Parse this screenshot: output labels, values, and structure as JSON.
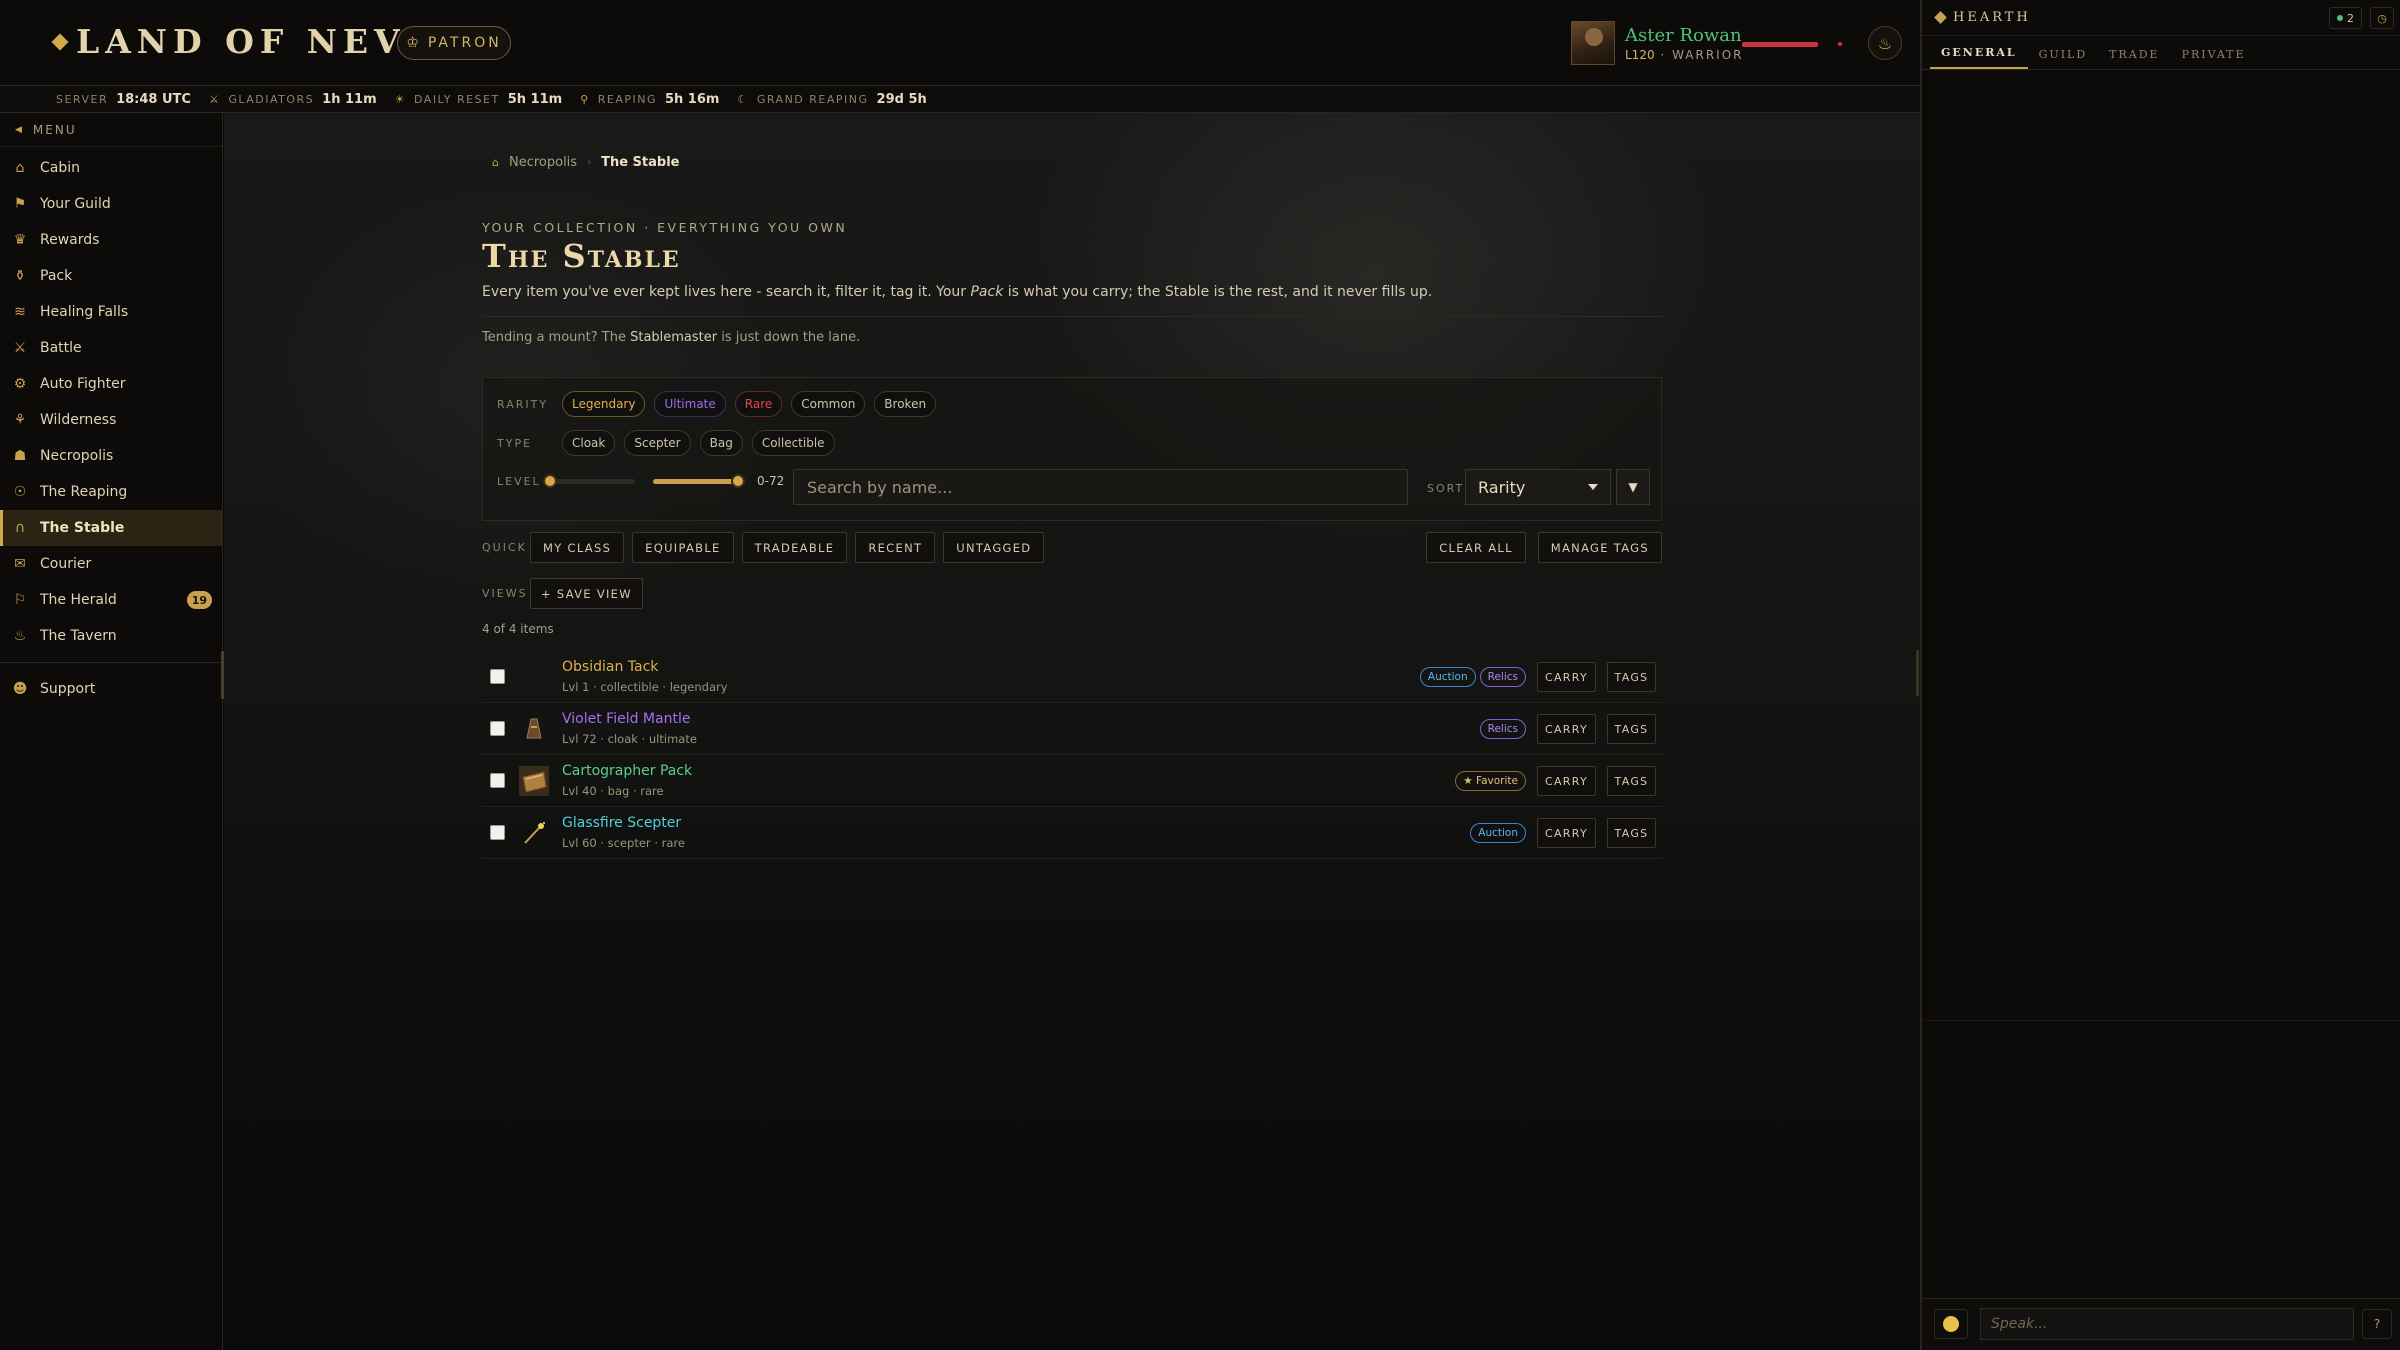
{
  "header": {
    "logo": "LAND OF NEVARD",
    "patron": "PATRON",
    "player": {
      "name": "Aster Rowan",
      "level": "L120",
      "class": "WARRIOR"
    }
  },
  "timers": [
    {
      "label": "SERVER",
      "value": "18:48 UTC",
      "icon": ""
    },
    {
      "label": "GLADIATORS",
      "value": "1h 11m",
      "icon": "⚔"
    },
    {
      "label": "DAILY RESET",
      "value": "5h 11m",
      "icon": "☀"
    },
    {
      "label": "REAPING",
      "value": "5h 16m",
      "icon": "⚲"
    },
    {
      "label": "GRAND REAPING",
      "value": "29d 5h",
      "icon": "☾"
    }
  ],
  "sidebar": {
    "menu_label": "MENU",
    "items": [
      {
        "label": "Cabin",
        "icon": "cabin-icon",
        "glyph": "⌂"
      },
      {
        "label": "Your Guild",
        "icon": "guild-icon",
        "glyph": "⚑"
      },
      {
        "label": "Rewards",
        "icon": "rewards-icon",
        "glyph": "♛"
      },
      {
        "label": "Pack",
        "icon": "pack-icon",
        "glyph": "⚱"
      },
      {
        "label": "Healing Falls",
        "icon": "healing-falls-icon",
        "glyph": "≋"
      },
      {
        "label": "Battle",
        "icon": "battle-icon",
        "glyph": "⚔"
      },
      {
        "label": "Auto Fighter",
        "icon": "auto-fighter-icon",
        "glyph": "⚙"
      },
      {
        "label": "Wilderness",
        "icon": "wilderness-icon",
        "glyph": "⚘"
      },
      {
        "label": "Necropolis",
        "icon": "necropolis-icon",
        "glyph": "☗"
      },
      {
        "label": "The Reaping",
        "icon": "reaping-icon",
        "glyph": "☉"
      },
      {
        "label": "The Stable",
        "icon": "horseshoe-icon",
        "glyph": "∩"
      },
      {
        "label": "Courier",
        "icon": "courier-icon",
        "glyph": "✉"
      },
      {
        "label": "The Herald",
        "icon": "herald-icon",
        "glyph": "⚐",
        "badge": "19"
      },
      {
        "label": "The Tavern",
        "icon": "tavern-icon",
        "glyph": "♨"
      }
    ],
    "support": {
      "label": "Support",
      "icon": "support-icon",
      "glyph": "☻"
    }
  },
  "breadcrumb": {
    "home": "Necropolis",
    "current": "The Stable"
  },
  "page": {
    "eyebrow": "YOUR COLLECTION · EVERYTHING YOU OWN",
    "title": "The Stable",
    "lede_a": "Every item you've ever kept lives here - search it, filter it, tag it. Your ",
    "lede_pack": "Pack",
    "lede_b": " is what you carry; the Stable is the rest, and it never fills up.",
    "tend_a": "Tending a mount? The ",
    "tend_link": "Stablemaster",
    "tend_b": " is just down the lane."
  },
  "filters": {
    "rarity_label": "RARITY",
    "rarity": [
      "Legendary",
      "Ultimate",
      "Rare",
      "Common",
      "Broken"
    ],
    "type_label": "TYPE",
    "types": [
      "Cloak",
      "Scepter",
      "Bag",
      "Collectible"
    ],
    "level_label": "LEVEL",
    "level_range": "0-72",
    "level_min": 0,
    "level_max": 72,
    "search_placeholder": "Search by name...",
    "sort_label": "SORT",
    "sort_value": "Rarity",
    "sort_dir_glyph": "▼"
  },
  "quick": {
    "label": "QUICK",
    "buttons": [
      "MY CLASS",
      "EQUIPABLE",
      "TRADEABLE",
      "RECENT",
      "UNTAGGED"
    ],
    "clear_all": "CLEAR ALL",
    "manage_tags": "MANAGE TAGS"
  },
  "views": {
    "label": "VIEWS",
    "save": "+ SAVE VIEW"
  },
  "count": "4 of 4 items",
  "items": [
    {
      "name": "Obsidian Tack",
      "meta": "Lvl 1 · collectible · legendary",
      "rarity": "legendary",
      "tags": [
        "Auction",
        "Relics"
      ],
      "icon": ""
    },
    {
      "name": "Violet Field Mantle",
      "meta": "Lvl 72 · cloak · ultimate",
      "rarity": "ultimate",
      "tags": [
        "Relics"
      ],
      "icon": "cloak-icon"
    },
    {
      "name": "Cartographer Pack",
      "meta": "Lvl 40 · bag · rare",
      "rarity": "rare",
      "tags": [
        "Favorite"
      ],
      "icon": "bag-icon"
    },
    {
      "name": "Glassfire Scepter",
      "meta": "Lvl 60 · scepter · rare",
      "rarity": "rare2",
      "tags": [
        "Auction"
      ],
      "icon": "scepter-icon"
    }
  ],
  "item_actions": {
    "carry": "CARRY",
    "tags": "TAGS"
  },
  "chat": {
    "title": "HEARTH",
    "online": "2",
    "tabs": [
      "GENERAL",
      "GUILD",
      "TRADE",
      "PRIVATE"
    ],
    "input_placeholder": "Speak...",
    "help": "?"
  },
  "colors": {
    "accent": "#c9a14e",
    "legendary": "#e0b04a",
    "ultimate": "#a66ff0",
    "rare": "#5ecd8e",
    "player_name": "#52c079",
    "hp": "#c7363f"
  }
}
